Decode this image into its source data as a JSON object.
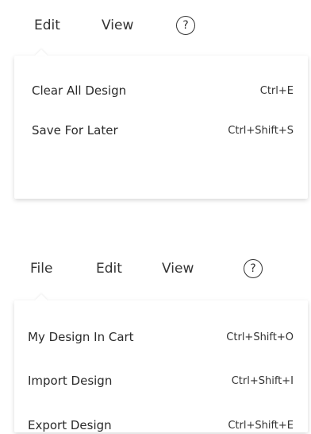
{
  "top_menu": {
    "tabs": [
      "Edit",
      "View"
    ],
    "help_glyph": "?",
    "items": [
      {
        "label": "Clear All Design",
        "shortcut": "Ctrl+E"
      },
      {
        "label": "Save For Later",
        "shortcut": "Ctrl+Shift+S"
      }
    ]
  },
  "bottom_menu": {
    "tabs": [
      "File",
      "Edit",
      "View"
    ],
    "help_glyph": "?",
    "items": [
      {
        "label": "My Design In Cart",
        "shortcut": "Ctrl+Shift+O"
      },
      {
        "label": "Import Design",
        "shortcut": "Ctrl+Shift+I"
      },
      {
        "label": "Export Design",
        "shortcut": "Ctrl+Shift+E"
      }
    ]
  },
  "icons": {
    "help": "help-circle-icon"
  }
}
